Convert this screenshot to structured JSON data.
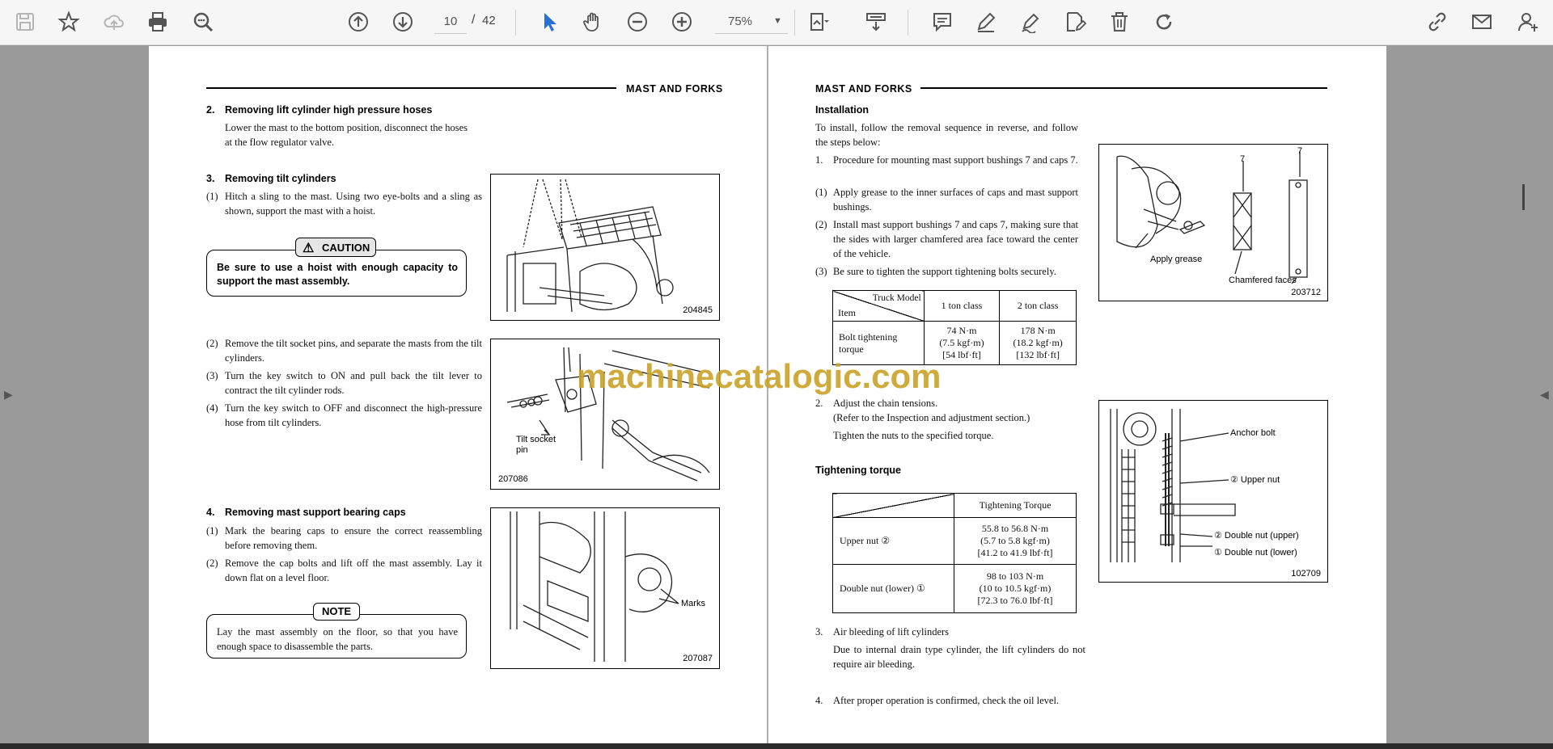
{
  "toolbar": {
    "page_current": "10",
    "page_separator": "/",
    "page_total": "42",
    "zoom": "75%"
  },
  "left_page": {
    "header": "MAST AND FORKS",
    "s2_num": "2.",
    "s2_title": "Removing lift cylinder high pressure hoses",
    "s2_body": "Lower the mast to the bottom position, disconnect the hoses at the flow regulator valve.",
    "s3_num": "3.",
    "s3_title": "Removing tilt cylinders",
    "s3_1_num": "(1)",
    "s3_1": "Hitch a sling to the mast.  Using two eye-bolts and a sling as shown, support the mast with a hoist.",
    "caution_label": "CAUTION",
    "caution_text": "Be sure to use a hoist with enough capacity to support the mast assembly.",
    "s3_2_num": "(2)",
    "s3_2": "Remove the tilt socket pins, and separate the masts from the tilt cylinders.",
    "s3_3_num": "(3)",
    "s3_3": "Turn the key switch to ON and pull back the tilt lever to contract the tilt cylinder rods.",
    "s3_4_num": "(4)",
    "s3_4": "Turn the key switch to OFF and disconnect the high-pressure hose from tilt cylinders.",
    "s4_num": "4.",
    "s4_title": "Removing mast support bearing caps",
    "s4_1_num": "(1)",
    "s4_1": "Mark the bearing caps to ensure the correct reassembling before removing them.",
    "s4_2_num": "(2)",
    "s4_2": "Remove the cap bolts and lift off the mast assembly. Lay it down flat on a level floor.",
    "note_label": "NOTE",
    "note_text": "Lay the mast assembly on the floor, so that you have enough space to disassemble the parts.",
    "fig1_id": "204845",
    "fig2_id": "207086",
    "fig2_label1": "Tilt socket",
    "fig2_label2": "pin",
    "fig3_id": "207087",
    "fig3_label": "Marks"
  },
  "right_page": {
    "header": "MAST AND FORKS",
    "install_title": "Installation",
    "install_body": "To install, follow the removal sequence in reverse, and follow the steps below:",
    "r1_num": "1.",
    "r1": "Procedure for mounting mast support bushings 7 and caps 7.",
    "r1_1_num": "(1)",
    "r1_1": "Apply grease to the inner surfaces of caps and mast support bushings.",
    "r1_2_num": "(2)",
    "r1_2": "Install mast support bushings 7 and caps 7, making sure that the sides with larger chamfered area face toward the center of the vehicle.",
    "r1_3_num": "(3)",
    "r1_3": "Be sure to tighten the support tightening bolts securely.",
    "table1": {
      "corner_top": "Truck Model",
      "corner_bottom": "Item",
      "col1": "1 ton class",
      "col2": "2 ton class",
      "row_label": "Bolt tightening torque",
      "val1_a": "74 N·m",
      "val1_b": "(7.5 kgf·m)",
      "val1_c": "[54 lbf·ft]",
      "val2_a": "178 N·m",
      "val2_b": "(18.2 kgf·m)",
      "val2_c": "[132 lbf·ft]"
    },
    "r2_num": "2.",
    "r2_a": "Adjust the chain tensions.",
    "r2_b": "(Refer to the Inspection and adjustment section.)",
    "r2_c": "Tighten the nuts to the specified torque.",
    "tight_title": "Tightening torque",
    "table2": {
      "header": "Tightening Torque",
      "row1_label": "Upper nut ②",
      "row1_a": "55.8 to 56.8 N·m",
      "row1_b": "(5.7 to 5.8 kgf·m)",
      "row1_c": "[41.2 to 41.9 lbf·ft]",
      "row2_label": "Double nut (lower) ①",
      "row2_a": "98 to 103 N·m",
      "row2_b": "(10 to 10.5 kgf·m)",
      "row2_c": "[72.3 to 76.0 lbf·ft]"
    },
    "r3_num": "3.",
    "r3_a": "Air bleeding of lift cylinders",
    "r3_b": "Due to internal drain type cylinder, the lift cylinders do not require air bleeding.",
    "r4_num": "4.",
    "r4": "After proper operation is confirmed, check the oil level.",
    "fig4_id": "203712",
    "fig4_label1": "Apply grease",
    "fig4_label2": "Chamfered faces",
    "fig4_num1": "7",
    "fig4_num2": "7",
    "fig5_id": "102709",
    "fig5_l1": "Anchor bolt",
    "fig5_l2": "② Upper nut",
    "fig5_l3": "② Double nut (upper)",
    "fig5_l4": "① Double nut (lower)"
  },
  "watermark": "machinecatalogic.com"
}
